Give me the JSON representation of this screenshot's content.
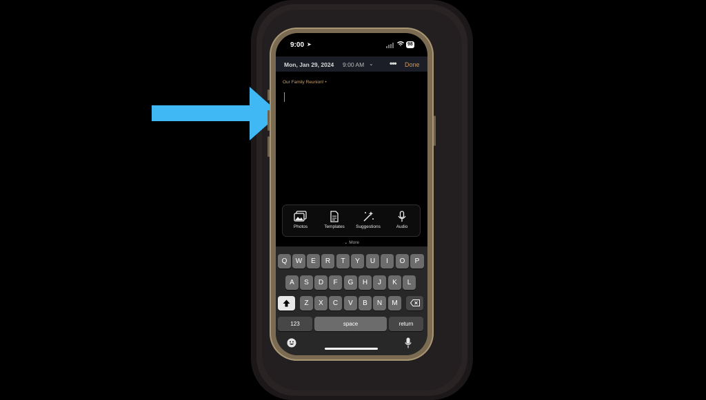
{
  "status_bar": {
    "time": "9:00",
    "battery": "98"
  },
  "nav": {
    "date": "Mon, Jan 29, 2024",
    "time": "9:00 AM",
    "done_label": "Done"
  },
  "journal": {
    "name": "Our Family Reunion!  •"
  },
  "toolbar": {
    "photos": "Photos",
    "templates": "Templates",
    "suggestions": "Suggestions",
    "audio": "Audio",
    "more": "More"
  },
  "keyboard": {
    "row1": [
      "Q",
      "W",
      "E",
      "R",
      "T",
      "Y",
      "U",
      "I",
      "O",
      "P"
    ],
    "row2": [
      "A",
      "S",
      "D",
      "F",
      "G",
      "H",
      "J",
      "K",
      "L"
    ],
    "row3": [
      "Z",
      "X",
      "C",
      "V",
      "B",
      "N",
      "M"
    ],
    "numbers": "123",
    "space": "space",
    "return": "return"
  },
  "colors": {
    "arrow": "#3fb8f4",
    "accent": "#c89a64",
    "journal_name": "#c8a26a"
  },
  "icons": [
    "location-arrow-icon",
    "wifi-icon",
    "signal-icon",
    "chevron-down-icon",
    "ellipsis-icon",
    "photos-icon",
    "templates-icon",
    "suggestions-icon",
    "microphone-icon",
    "shift-icon",
    "delete-icon",
    "emoji-icon"
  ]
}
